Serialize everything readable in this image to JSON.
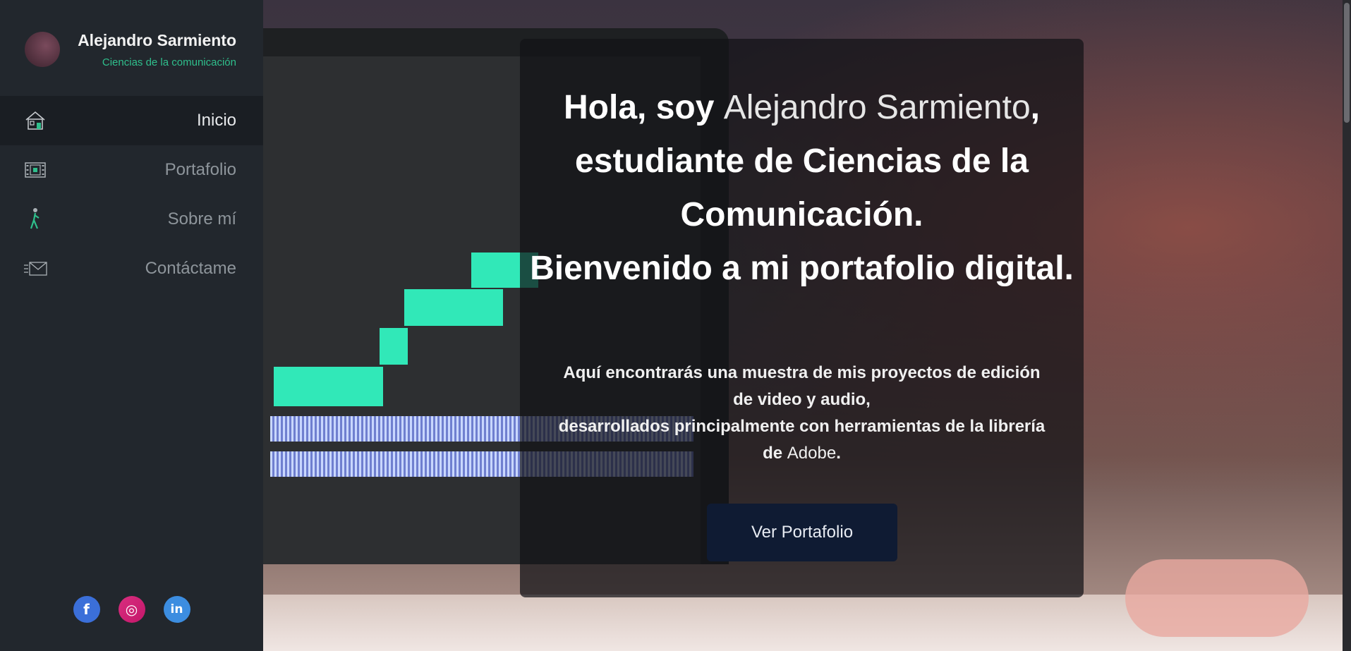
{
  "sidebar": {
    "profile": {
      "name": "Alejandro Sarmiento",
      "subtitle": "Ciencias de la comunicación"
    },
    "items": [
      {
        "label": "Inicio",
        "icon": "house-icon",
        "active": true
      },
      {
        "label": "Portafolio",
        "icon": "film-icon",
        "active": false
      },
      {
        "label": "Sobre mí",
        "icon": "walking-person-icon",
        "active": false
      },
      {
        "label": "Contáctame",
        "icon": "envelope-icon",
        "active": false
      }
    ],
    "socials": [
      {
        "name": "facebook-icon",
        "glyph": "f"
      },
      {
        "name": "instagram-icon",
        "glyph": "◎"
      },
      {
        "name": "linkedin-icon",
        "glyph": "in"
      }
    ]
  },
  "hero": {
    "headline": {
      "greeting": "Hola, soy ",
      "name": "Alejandro Sarmiento",
      "comma": ",",
      "line2": "estudiante de Ciencias de la Comunicación.",
      "line3": "Bienvenido a mi portafolio digital."
    },
    "description": {
      "line1": "Aquí encontrarás una muestra de mis proyectos de edición de video y audio,",
      "line2_bold": "desarrollados principalmente con herramientas de la librería de ",
      "line2_light": "Adobe",
      "line2_end": "."
    },
    "cta_label": "Ver Portafolio"
  },
  "colors": {
    "sidebar_bg": "#22272d",
    "accent_green": "#2fbf8c",
    "cta_bg": "#0f1b33"
  }
}
